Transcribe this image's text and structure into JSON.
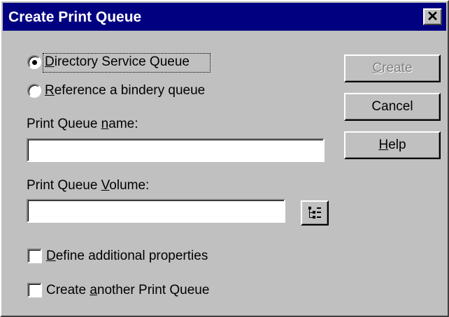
{
  "window": {
    "title": "Create Print Queue"
  },
  "radios": [
    {
      "pre": "",
      "mn": "D",
      "post": "irectory Service Queue",
      "checked": true
    },
    {
      "pre": "",
      "mn": "R",
      "post": "eference a bindery queue",
      "checked": false
    }
  ],
  "name_field": {
    "pre": "Print Queue ",
    "mn": "n",
    "post": "ame:",
    "value": ""
  },
  "volume_field": {
    "pre": "Print Queue ",
    "mn": "V",
    "post": "olume:",
    "value": ""
  },
  "checkboxes": [
    {
      "pre": "",
      "mn": "D",
      "post": "efine additional properties",
      "checked": false
    },
    {
      "pre": "Create ",
      "mn": "a",
      "post": "nother Print Queue",
      "checked": false
    }
  ],
  "buttons": {
    "create": {
      "pre": "",
      "mn": "C",
      "post": "reate",
      "enabled": false
    },
    "cancel": {
      "label": "Cancel"
    },
    "help": {
      "pre": "",
      "mn": "H",
      "post": "elp"
    }
  },
  "icons": {
    "close": "close-icon",
    "browse": "tree-browse-icon"
  }
}
